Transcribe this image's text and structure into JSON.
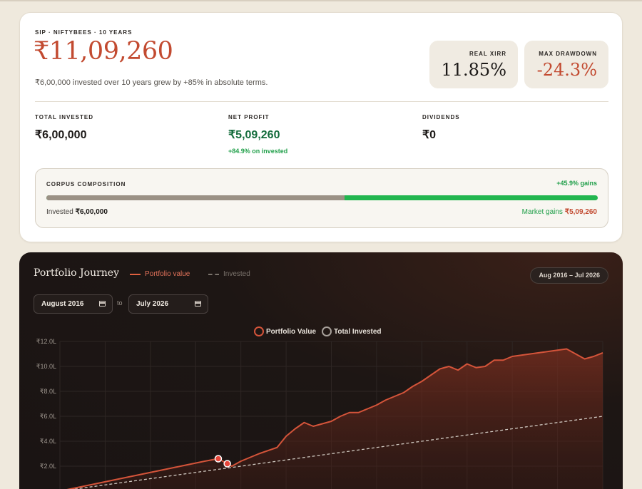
{
  "summary": {
    "eyebrow": "SIP · NIFTYBEES · 10 YEARS",
    "final_value": "₹11,09,260",
    "subtext": "₹6,00,000 invested over 10 years grew by +85% in absolute terms.",
    "xirr": {
      "label": "REAL XIRR",
      "value": "11.85%"
    },
    "drawdown": {
      "label": "MAX DRAWDOWN",
      "value": "-24.3%"
    },
    "total_invested": {
      "label": "TOTAL INVESTED",
      "value": "₹6,00,000"
    },
    "net_profit": {
      "label": "NET PROFIT",
      "value": "₹5,09,260",
      "sub": "+84.9% on invested"
    },
    "dividends": {
      "label": "DIVIDENDS",
      "value": "₹0"
    }
  },
  "composition": {
    "label": "CORPUS COMPOSITION",
    "gains_text": "+45.9% gains",
    "invested_label": "Invested",
    "invested_value": "₹6,00,000",
    "gains_label": "Market gains",
    "gains_value": "₹5,09,260",
    "invested_fraction": 0.541,
    "colors": {
      "invested": "#9b9185",
      "gains": "#22b64f"
    }
  },
  "journey": {
    "title": "Portfolio Journey",
    "legend_portfolio": "Portfolio value",
    "legend_invested": "Invested",
    "range_badge": "Aug 2016 – Jul 2026",
    "from_date": "August 2016",
    "to_label": "to",
    "to_date": "July 2026",
    "icons": [
      "calendar-icon"
    ]
  },
  "chart_data": {
    "type": "line",
    "legend": [
      "Portfolio Value",
      "Total Invested"
    ],
    "y_ticks": [
      "₹2.0L",
      "₹4.0L",
      "₹6.0L",
      "₹8.0L",
      "₹10.0L",
      "₹12.0L"
    ],
    "ylim": [
      0,
      12.0
    ],
    "xlim": [
      0,
      120
    ],
    "x_unit": "months since Aug 2016",
    "y_unit": "lakh ₹",
    "colors": {
      "portfolio": "#d4543a",
      "invested": "#cfc8c0"
    },
    "series": [
      {
        "name": "Portfolio Value",
        "x": [
          0,
          4,
          8,
          12,
          16,
          20,
          24,
          28,
          32,
          35,
          37,
          38,
          40,
          44,
          48,
          50,
          52,
          54,
          56,
          58,
          60,
          62,
          64,
          66,
          68,
          70,
          72,
          74,
          76,
          78,
          80,
          82,
          84,
          86,
          88,
          90,
          92,
          94,
          96,
          98,
          100,
          102,
          104,
          106,
          108,
          110,
          112,
          114,
          116,
          118,
          120
        ],
        "values": [
          0.0,
          0.3,
          0.6,
          0.9,
          1.2,
          1.5,
          1.8,
          2.1,
          2.4,
          2.6,
          2.2,
          2.0,
          2.4,
          3.0,
          3.5,
          4.4,
          5.0,
          5.5,
          5.2,
          5.4,
          5.6,
          6.0,
          6.3,
          6.3,
          6.6,
          6.9,
          7.3,
          7.6,
          7.9,
          8.4,
          8.8,
          9.3,
          9.8,
          10.0,
          9.7,
          10.2,
          9.9,
          10.0,
          10.5,
          10.5,
          10.8,
          10.9,
          11.0,
          11.1,
          11.2,
          11.3,
          11.4,
          11.0,
          10.6,
          10.8,
          11.09
        ]
      },
      {
        "name": "Total Invested",
        "x": [
          0,
          120
        ],
        "values": [
          0.0,
          6.0
        ]
      }
    ],
    "markers": [
      {
        "series": "Portfolio Value",
        "x": 35,
        "value": 2.6
      },
      {
        "series": "Portfolio Value",
        "x": 37,
        "value": 2.2
      }
    ]
  }
}
